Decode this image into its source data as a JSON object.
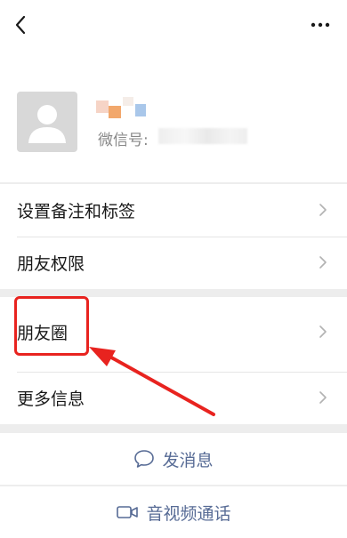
{
  "header": {
    "back_icon": "chevron-left-icon",
    "more_icon": "more-dots-icon"
  },
  "profile": {
    "avatar_icon": "default-avatar-icon",
    "wechat_id_label": "微信号:"
  },
  "menu": {
    "remark_tags": "设置备注和标签",
    "friend_permissions": "朋友权限",
    "moments": "朋友圈",
    "more_info": "更多信息"
  },
  "actions": {
    "send_message": "发消息",
    "video_call": "音视频通话"
  },
  "annotation": {
    "color": "#e8231f"
  },
  "colors": {
    "link": "#576b95",
    "background": "#ededed"
  }
}
